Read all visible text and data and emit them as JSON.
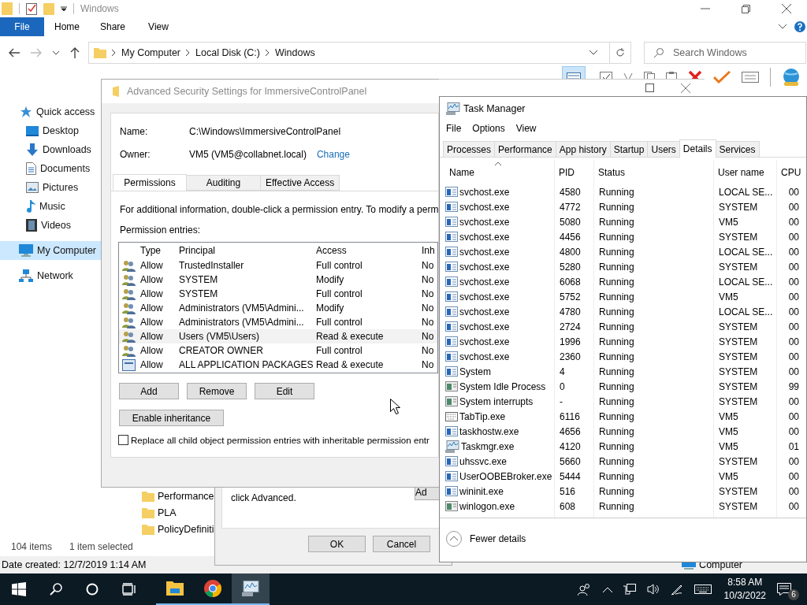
{
  "explorer": {
    "title": "Windows",
    "file_tab": "File",
    "tabs": [
      "Home",
      "Share",
      "View"
    ],
    "breadcrumbs": [
      "My Computer",
      "Local Disk (C:)",
      "Windows"
    ],
    "search": {
      "placeholder": "Search Windows"
    },
    "nav": [
      {
        "label": "Quick access",
        "kind": "star",
        "selected": false,
        "children": [
          {
            "label": "Desktop",
            "kind": "desktop",
            "selected": false
          },
          {
            "label": "Downloads",
            "kind": "download",
            "selected": false
          },
          {
            "label": "Documents",
            "kind": "document",
            "selected": false
          },
          {
            "label": "Pictures",
            "kind": "pictures",
            "selected": false
          },
          {
            "label": "Music",
            "kind": "music",
            "selected": false
          },
          {
            "label": "Videos",
            "kind": "video",
            "selected": false
          }
        ]
      },
      {
        "label": "My Computer",
        "kind": "computer",
        "selected": true
      },
      {
        "label": "Network",
        "kind": "network",
        "selected": false
      }
    ],
    "files": [
      "Performance",
      "PLA",
      "PolicyDefiniti"
    ],
    "item_count": "104 items",
    "selection": "1 item selected",
    "details": "Date created: 12/7/2019 1:14 AM",
    "drive": "Computer"
  },
  "properties_dialog": {
    "text": "click Advanced.",
    "advanced_button": "Ad",
    "buttons": [
      "OK",
      "Cancel"
    ]
  },
  "security": {
    "title": "Advanced Security Settings for ImmersiveControlPanel",
    "name_label": "Name:",
    "name_value": "C:\\Windows\\ImmersiveControlPanel",
    "owner_label": "Owner:",
    "owner_value": "VM5 (VM5@collabnet.local)",
    "change_link": "Change",
    "tabs": [
      {
        "label": "Permissions",
        "selected": true
      },
      {
        "label": "Auditing",
        "selected": false
      },
      {
        "label": "Effective Access",
        "selected": false
      }
    ],
    "info": "For additional information, double-click a permission entry. To modify a perm",
    "entries_label": "Permission entries:",
    "columns": [
      "Type",
      "Principal",
      "Access",
      "Inh"
    ],
    "rows": [
      {
        "kind": "user",
        "type": "Allow",
        "principal": "TrustedInstaller",
        "access": "Full control",
        "inherited": "No",
        "selected": false
      },
      {
        "kind": "user",
        "type": "Allow",
        "principal": "SYSTEM",
        "access": "Modify",
        "inherited": "No",
        "selected": false
      },
      {
        "kind": "user",
        "type": "Allow",
        "principal": "SYSTEM",
        "access": "Full control",
        "inherited": "No",
        "selected": false
      },
      {
        "kind": "user",
        "type": "Allow",
        "principal": "Administrators (VM5\\Admini...",
        "access": "Modify",
        "inherited": "No",
        "selected": false
      },
      {
        "kind": "user",
        "type": "Allow",
        "principal": "Administrators (VM5\\Admini...",
        "access": "Full control",
        "inherited": "No",
        "selected": false
      },
      {
        "kind": "user",
        "type": "Allow",
        "principal": "Users (VM5\\Users)",
        "access": "Read & execute",
        "inherited": "No",
        "selected": true
      },
      {
        "kind": "user",
        "type": "Allow",
        "principal": "CREATOR OWNER",
        "access": "Full control",
        "inherited": "No",
        "selected": false
      },
      {
        "kind": "package",
        "type": "Allow",
        "principal": "ALL APPLICATION PACKAGES",
        "access": "Read & execute",
        "inherited": "No",
        "selected": false
      }
    ],
    "buttons": [
      "Add",
      "Remove",
      "Edit"
    ],
    "inheritance_button": "Enable inheritance",
    "replace": {
      "label": "Replace all child object permission entries with inheritable permission entr",
      "checked": false
    }
  },
  "task_manager": {
    "title": "Task Manager",
    "menu": [
      "File",
      "Options",
      "View"
    ],
    "tabs": [
      {
        "label": "Processes",
        "selected": false
      },
      {
        "label": "Performance",
        "selected": false
      },
      {
        "label": "App history",
        "selected": false
      },
      {
        "label": "Startup",
        "selected": false
      },
      {
        "label": "Users",
        "selected": false
      },
      {
        "label": "Details",
        "selected": true
      },
      {
        "label": "Services",
        "selected": false
      }
    ],
    "columns": [
      "Name",
      "PID",
      "Status",
      "User name",
      "CPU"
    ],
    "rows": [
      {
        "kind": "service",
        "name": "svchost.exe",
        "pid": "4580",
        "status": "Running",
        "user": "LOCAL SE...",
        "cpu": "00"
      },
      {
        "kind": "service",
        "name": "svchost.exe",
        "pid": "4772",
        "status": "Running",
        "user": "SYSTEM",
        "cpu": "00"
      },
      {
        "kind": "service",
        "name": "svchost.exe",
        "pid": "5080",
        "status": "Running",
        "user": "VM5",
        "cpu": "00"
      },
      {
        "kind": "service",
        "name": "svchost.exe",
        "pid": "4456",
        "status": "Running",
        "user": "SYSTEM",
        "cpu": "00"
      },
      {
        "kind": "service",
        "name": "svchost.exe",
        "pid": "4800",
        "status": "Running",
        "user": "LOCAL SE...",
        "cpu": "00"
      },
      {
        "kind": "service",
        "name": "svchost.exe",
        "pid": "5280",
        "status": "Running",
        "user": "SYSTEM",
        "cpu": "00"
      },
      {
        "kind": "service",
        "name": "svchost.exe",
        "pid": "6068",
        "status": "Running",
        "user": "LOCAL SE...",
        "cpu": "00"
      },
      {
        "kind": "service",
        "name": "svchost.exe",
        "pid": "5752",
        "status": "Running",
        "user": "VM5",
        "cpu": "00"
      },
      {
        "kind": "service",
        "name": "svchost.exe",
        "pid": "4780",
        "status": "Running",
        "user": "LOCAL SE...",
        "cpu": "00"
      },
      {
        "kind": "service",
        "name": "svchost.exe",
        "pid": "2724",
        "status": "Running",
        "user": "SYSTEM",
        "cpu": "00"
      },
      {
        "kind": "service",
        "name": "svchost.exe",
        "pid": "1996",
        "status": "Running",
        "user": "SYSTEM",
        "cpu": "00"
      },
      {
        "kind": "service",
        "name": "svchost.exe",
        "pid": "2360",
        "status": "Running",
        "user": "SYSTEM",
        "cpu": "00"
      },
      {
        "kind": "service",
        "name": "System",
        "pid": "4",
        "status": "Running",
        "user": "SYSTEM",
        "cpu": "00"
      },
      {
        "kind": "system",
        "name": "System Idle Process",
        "pid": "0",
        "status": "Running",
        "user": "SYSTEM",
        "cpu": "99"
      },
      {
        "kind": "system",
        "name": "System interrupts",
        "pid": "-",
        "status": "Running",
        "user": "SYSTEM",
        "cpu": "00"
      },
      {
        "kind": "keyboard",
        "name": "TabTip.exe",
        "pid": "6116",
        "status": "Running",
        "user": "VM5",
        "cpu": "00"
      },
      {
        "kind": "service",
        "name": "taskhostw.exe",
        "pid": "4656",
        "status": "Running",
        "user": "VM5",
        "cpu": "00"
      },
      {
        "kind": "monitor",
        "name": "Taskmgr.exe",
        "pid": "4120",
        "status": "Running",
        "user": "VM5",
        "cpu": "01"
      },
      {
        "kind": "service",
        "name": "uhssvc.exe",
        "pid": "5660",
        "status": "Running",
        "user": "SYSTEM",
        "cpu": "00"
      },
      {
        "kind": "service",
        "name": "UserOOBEBroker.exe",
        "pid": "5444",
        "status": "Running",
        "user": "VM5",
        "cpu": "00"
      },
      {
        "kind": "service",
        "name": "wininit.exe",
        "pid": "516",
        "status": "Running",
        "user": "SYSTEM",
        "cpu": "00"
      },
      {
        "kind": "system",
        "name": "winlogon.exe",
        "pid": "608",
        "status": "Running",
        "user": "SYSTEM",
        "cpu": "00"
      }
    ],
    "fewer_details": "Fewer details"
  },
  "taskbar": {
    "apps": [
      {
        "kind": "explorer",
        "selected": false
      },
      {
        "kind": "chrome",
        "selected": false
      },
      {
        "kind": "monitor",
        "selected": true
      }
    ],
    "time": "8:58 AM",
    "date": "10/3/2022",
    "notifications": "6"
  }
}
